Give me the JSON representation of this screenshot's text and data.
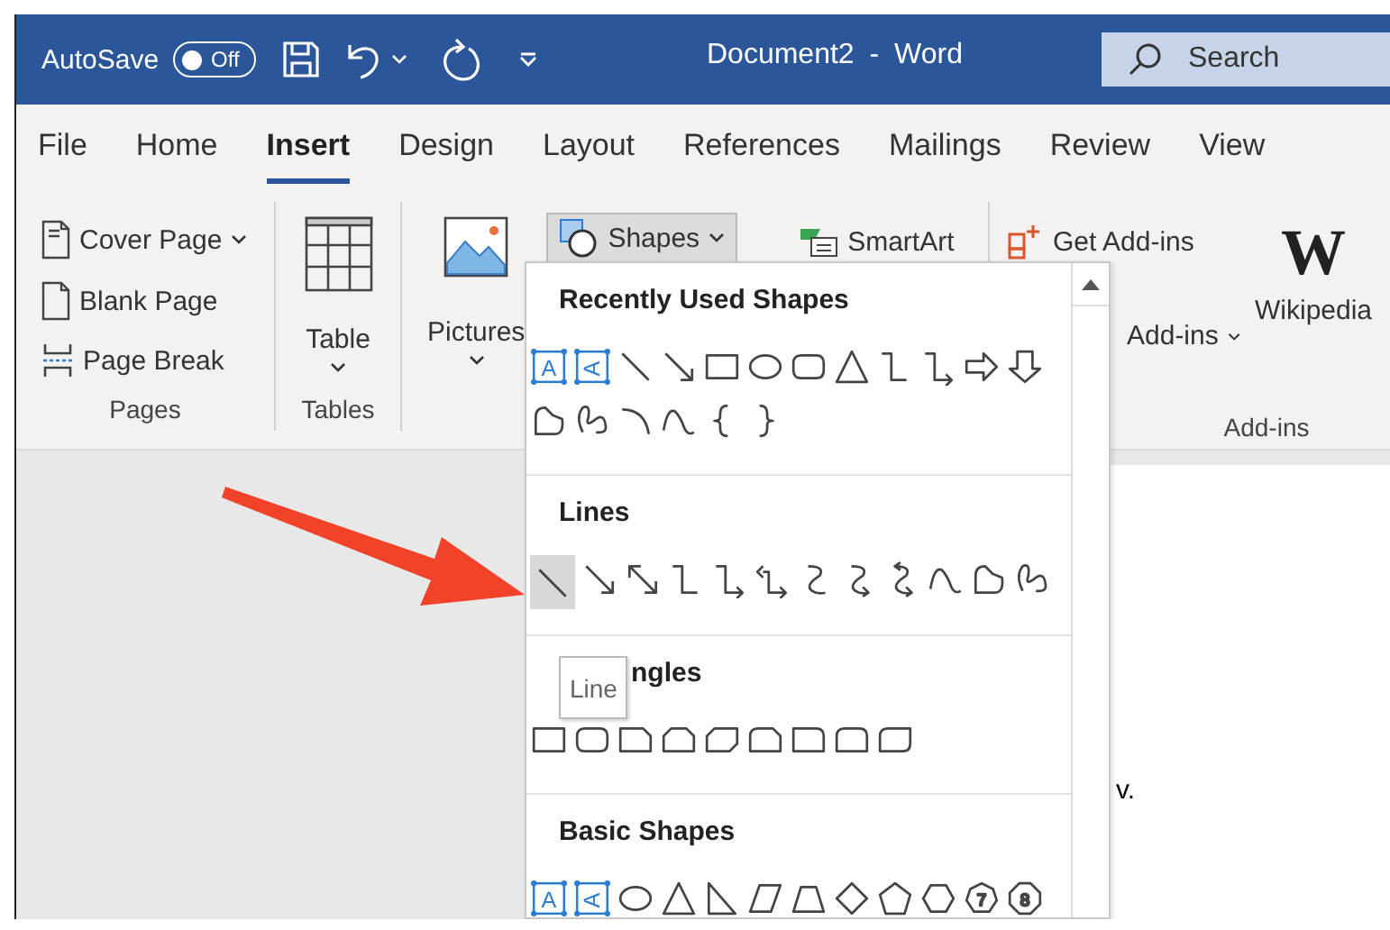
{
  "window": {
    "title": "Document2 - Word"
  },
  "quick_access": {
    "autosave_label": "AutoSave",
    "autosave": {
      "on": false,
      "label": "Off"
    }
  },
  "search": {
    "placeholder": "Search"
  },
  "tabs": [
    {
      "label": "File",
      "selected": false
    },
    {
      "label": "Home",
      "selected": false
    },
    {
      "label": "Insert",
      "selected": true
    },
    {
      "label": "Design",
      "selected": false
    },
    {
      "label": "Layout",
      "selected": false
    },
    {
      "label": "References",
      "selected": false
    },
    {
      "label": "Mailings",
      "selected": false
    },
    {
      "label": "Review",
      "selected": false
    },
    {
      "label": "View",
      "selected": false
    }
  ],
  "pages_group": {
    "label": "Pages",
    "items": [
      {
        "label": "Cover Page",
        "dropdown": true
      },
      {
        "label": "Blank Page",
        "dropdown": false
      },
      {
        "label": "Page Break",
        "dropdown": false
      }
    ]
  },
  "tables_group": {
    "label": "Tables",
    "button": "Table"
  },
  "illustrations": {
    "pictures": "Pictures",
    "shapes": {
      "label": "Shapes",
      "expanded": true
    },
    "smartart": "SmartArt"
  },
  "addins_group": {
    "label": "Add-ins",
    "get_addins": "Get Add-ins",
    "my_addins": "Add-ins",
    "wikipedia": {
      "logo": "W",
      "label": "Wikipedia"
    }
  },
  "shapes_menu": {
    "tooltip": "Line",
    "sections": [
      {
        "title": "Recently Used Shapes",
        "shapes": [
          {
            "kind": "textbox",
            "label": "A"
          },
          {
            "kind": "vtextbox",
            "label": "A"
          },
          {
            "kind": "line"
          },
          {
            "kind": "arrow"
          },
          {
            "kind": "rectangle"
          },
          {
            "kind": "oval"
          },
          {
            "kind": "roundrect"
          },
          {
            "kind": "triangle"
          },
          {
            "kind": "elbow"
          },
          {
            "kind": "elbowarrow"
          },
          {
            "kind": "rightarrow"
          },
          {
            "kind": "downarrow"
          },
          {
            "kind": "freeform"
          },
          {
            "kind": "scribble"
          },
          {
            "kind": "arc"
          },
          {
            "kind": "curve"
          },
          {
            "kind": "leftbrace"
          },
          {
            "kind": "rightbrace"
          }
        ]
      },
      {
        "title": "Lines",
        "shapes": [
          {
            "kind": "line",
            "hovered": true
          },
          {
            "kind": "arrow",
            "hovered": false
          },
          {
            "kind": "doublearrow",
            "hovered": false
          },
          {
            "kind": "elbow",
            "hovered": false
          },
          {
            "kind": "elbowarrow",
            "hovered": false
          },
          {
            "kind": "elbowdouble",
            "hovered": false
          },
          {
            "kind": "curveconn",
            "hovered": false
          },
          {
            "kind": "curvearrow",
            "hovered": false
          },
          {
            "kind": "curvedouble",
            "hovered": false
          },
          {
            "kind": "curve",
            "hovered": false
          },
          {
            "kind": "freeform",
            "hovered": false
          },
          {
            "kind": "scribble",
            "hovered": false
          }
        ]
      },
      {
        "title": "ngles",
        "shapes": [
          {
            "kind": "rectangle"
          },
          {
            "kind": "roundrect"
          },
          {
            "kind": "snipone"
          },
          {
            "kind": "snipsame"
          },
          {
            "kind": "snipdiag"
          },
          {
            "kind": "sniproundone"
          },
          {
            "kind": "roundone"
          },
          {
            "kind": "roundsame"
          },
          {
            "kind": "rounddiag"
          }
        ]
      },
      {
        "title": "Basic Shapes",
        "shapes": [
          {
            "kind": "textbox",
            "label": "A"
          },
          {
            "kind": "vtextbox",
            "label": "A"
          },
          {
            "kind": "oval"
          },
          {
            "kind": "triangle"
          },
          {
            "kind": "righttriangle"
          },
          {
            "kind": "parallelogram"
          },
          {
            "kind": "trapezoid"
          },
          {
            "kind": "diamond"
          },
          {
            "kind": "pentagon"
          },
          {
            "kind": "hexagon"
          },
          {
            "kind": "heptagon",
            "label": "7"
          },
          {
            "kind": "octagon",
            "label": "8"
          }
        ]
      }
    ]
  },
  "document": {
    "text": "v."
  }
}
